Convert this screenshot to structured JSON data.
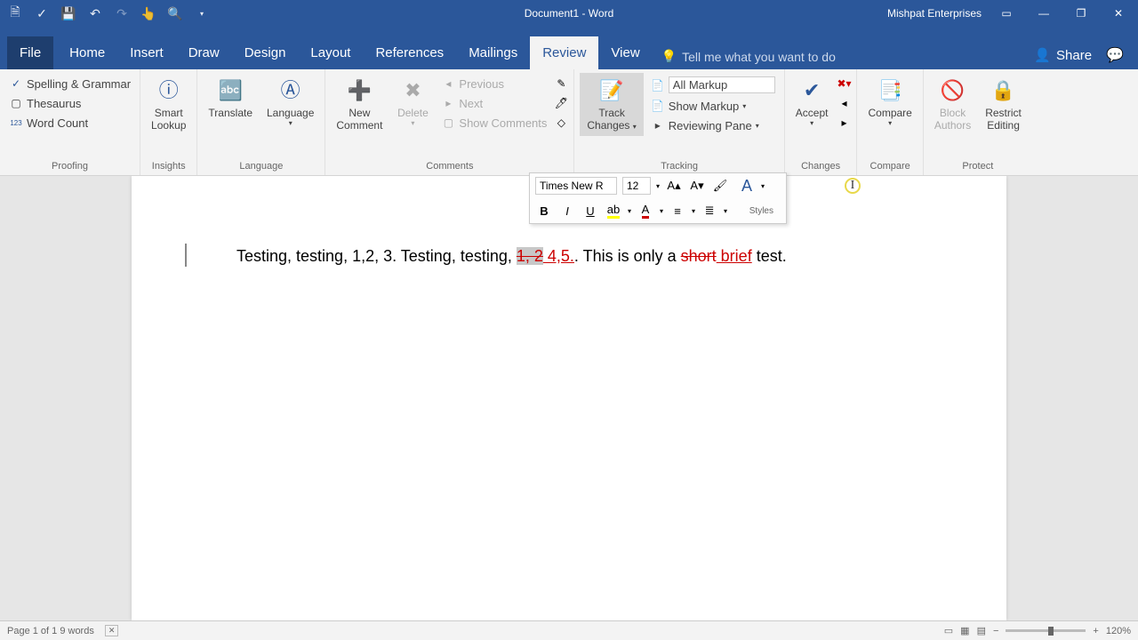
{
  "title": "Document1 - Word",
  "account": "Mishpat Enterprises",
  "tabs": {
    "file": "File",
    "home": "Home",
    "insert": "Insert",
    "draw": "Draw",
    "design": "Design",
    "layout": "Layout",
    "references": "References",
    "mailings": "Mailings",
    "review": "Review",
    "view": "View"
  },
  "tell_me": "Tell me what you want to do",
  "share": "Share",
  "ribbon": {
    "proofing": {
      "spelling": "Spelling & Grammar",
      "thesaurus": "Thesaurus",
      "wordcount": "Word Count",
      "label": "Proofing"
    },
    "insights": {
      "smart": "Smart",
      "lookup": "Lookup",
      "label": "Insights"
    },
    "language": {
      "translate": "Translate",
      "language": "Language",
      "label": "Language"
    },
    "comments": {
      "new": "New",
      "comment": "Comment",
      "delete": "Delete",
      "previous": "Previous",
      "next": "Next",
      "show": "Show Comments",
      "label": "Comments"
    },
    "tracking": {
      "track": "Track",
      "changes": "Changes",
      "markup": "All Markup",
      "show_markup": "Show Markup",
      "reviewing": "Reviewing Pane",
      "label": "Tracking"
    },
    "changes": {
      "accept": "Accept",
      "label": "Changes"
    },
    "compare": {
      "compare": "Compare",
      "label": "Compare"
    },
    "protect": {
      "block": "Block",
      "authors": "Authors",
      "restrict": "Restrict",
      "editing": "Editing",
      "label": "Protect"
    }
  },
  "mini": {
    "font": "Times New R",
    "size": "12",
    "styles": "Styles"
  },
  "doc": {
    "part1": "Testing, testing, 1,2, 3. Testing, testing, ",
    "del1": "1, 2",
    "ins1": " 4,5.",
    "part2": ". This is only a ",
    "del2": "short",
    "ins2": " brief",
    "part3": " test."
  },
  "status": {
    "left": "Page 1 of 1   9 words",
    "zoom": "120%"
  }
}
